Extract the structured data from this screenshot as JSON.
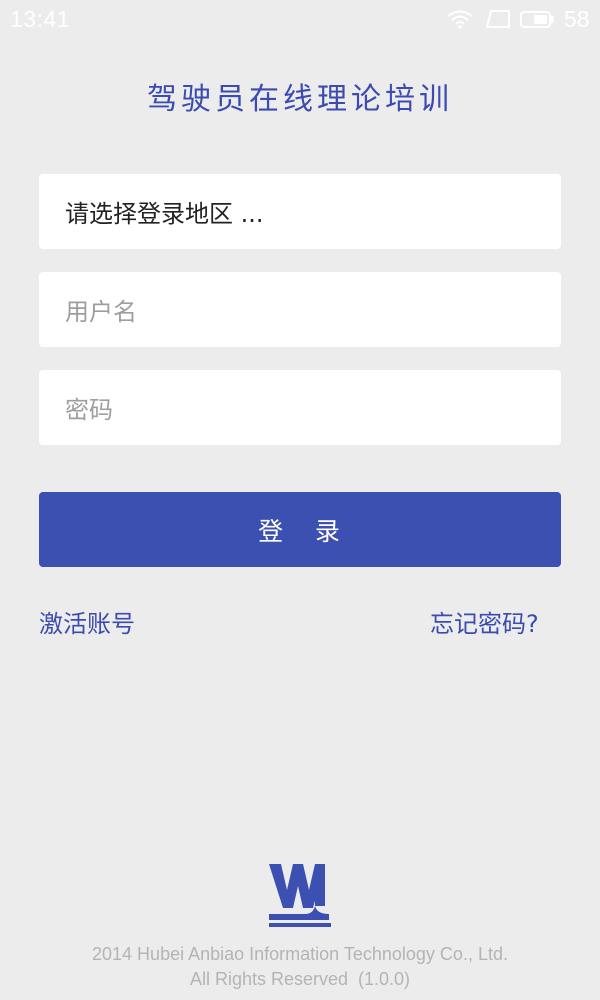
{
  "status_bar": {
    "time": "13:41",
    "battery_level": "58",
    "icons": [
      "wifi-icon",
      "screen-rotate-icon",
      "battery-icon"
    ]
  },
  "app": {
    "title": "驾驶员在线理论培训",
    "accent_color": "#3c50b2"
  },
  "form": {
    "region_select_text": "请选择登录地区 ...",
    "username_placeholder": "用户名",
    "password_placeholder": "密码",
    "login_label": "登   录"
  },
  "links": {
    "activate": "激活账号",
    "forgot_password": "忘记密码?"
  },
  "footer": {
    "logo": "wj-logo",
    "copyright_line1": "2014 Hubei Anbiao Information Technology Co., Ltd.",
    "copyright_line2": "All Rights Reserved  (1.0.0)"
  }
}
